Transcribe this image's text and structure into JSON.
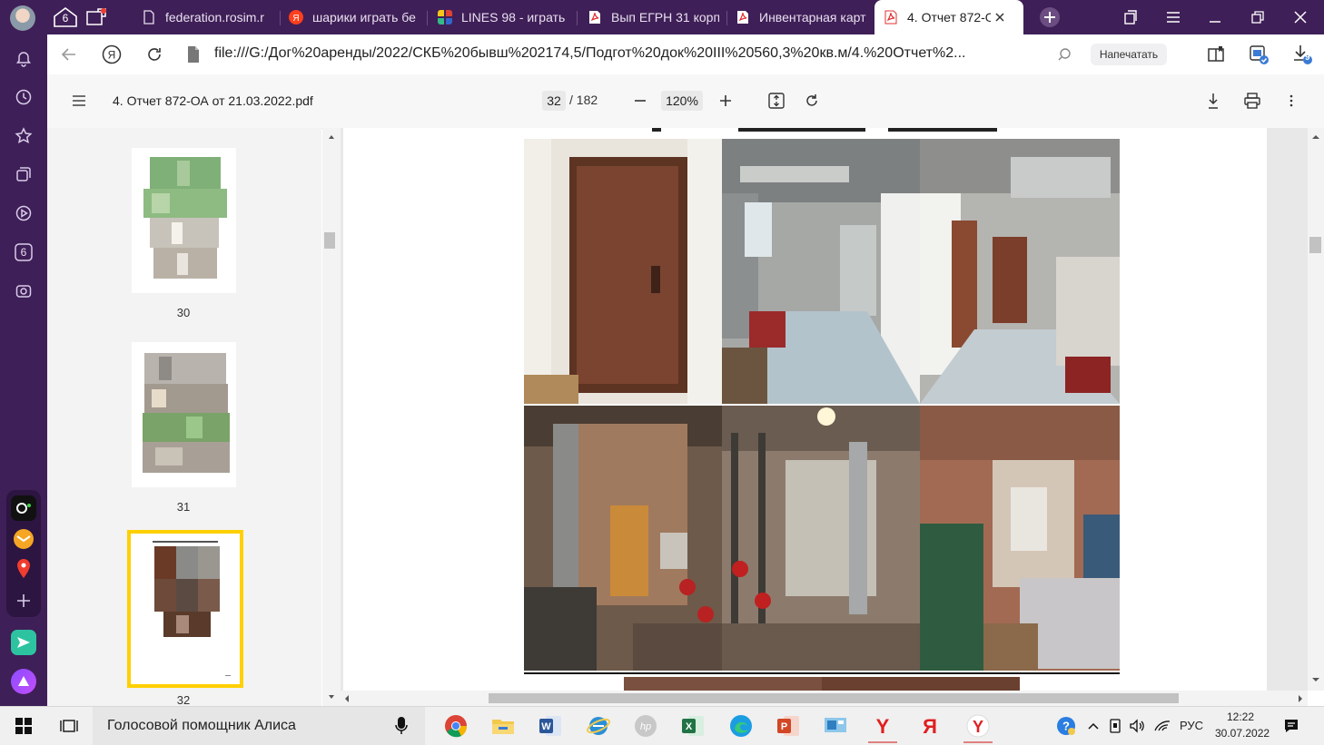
{
  "tabbar": {
    "tabs": [
      {
        "label": "federation.rosim.r",
        "icon": "doc-icon",
        "active": false
      },
      {
        "label": "шарики играть бе",
        "icon": "yandex-icon",
        "active": false
      },
      {
        "label": "LINES 98 - играть",
        "icon": "lines-icon",
        "active": false
      },
      {
        "label": "Вып ЕГРН 31 корп",
        "icon": "pdf-icon",
        "active": false
      },
      {
        "label": "Инвентарная карт",
        "icon": "pdf-icon",
        "active": false
      },
      {
        "label": "4. Отчет 872-О/",
        "icon": "pdf-icon",
        "active": true
      }
    ],
    "left_badge": "6"
  },
  "addressbar": {
    "url": "file:///G:/Дог%20аренды/2022/СКБ%20бывш%202174,5/Подгот%20док%20III%20560,3%20кв.м/4.%20Отчет%2...",
    "print_label": "Напечатать",
    "downloads_count": "9"
  },
  "pdf_toolbar": {
    "filename": "4. Отчет 872-ОА от 21.03.2022.pdf",
    "current_page": "32",
    "total_pages": "/ 182",
    "zoom": "120%"
  },
  "sidebar": {
    "thumbnails": [
      {
        "page": "30",
        "selected": false
      },
      {
        "page": "31",
        "selected": false
      },
      {
        "page": "32",
        "selected": true
      }
    ]
  },
  "leftbar": {
    "badge": "6"
  },
  "taskbar": {
    "search_text": "Голосовой помощник Алиса",
    "language": "РУС",
    "time": "12:22",
    "date": "30.07.2022"
  },
  "colors": {
    "browser_purple": "#3f1f57",
    "selection_yellow": "#ffd000"
  }
}
